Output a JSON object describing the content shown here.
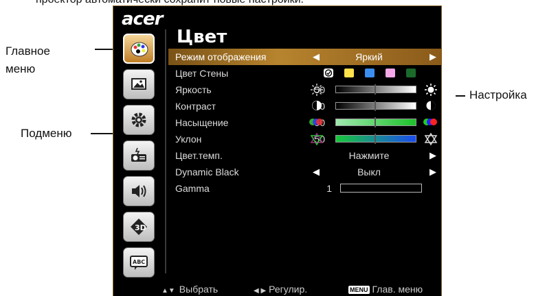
{
  "top_caption": "проектор автоматически сохранит новые настройки.",
  "callouts": {
    "main_menu": "Главное\nменю",
    "submenu": "Подменю",
    "setting": "Настройка"
  },
  "osd": {
    "logo": "acer",
    "title": "Цвет",
    "sidebar_icons": [
      "palette-icon",
      "image-icon",
      "gear-icon",
      "projector-icon",
      "speaker-icon",
      "3d-icon",
      "abc-language-icon"
    ],
    "rows": [
      {
        "label": "Режим отображения",
        "kind": "option",
        "value": "Яркий",
        "highlighted": true
      },
      {
        "label": "Цвет Стены",
        "kind": "swatches",
        "swatches": [
          "#ffe14a",
          "#3b8ef0",
          "#f4a8e8",
          "#1a6a2a"
        ]
      },
      {
        "label": "Яркость",
        "kind": "slider",
        "value": "50",
        "level_pct": 50
      },
      {
        "label": "Контраст",
        "kind": "slider",
        "value": "50",
        "level_pct": 50
      },
      {
        "label": "Насыщение",
        "kind": "slider",
        "value": "50",
        "level_pct": 50
      },
      {
        "label": "Уклон",
        "kind": "slider",
        "value": "50",
        "level_pct": 50
      },
      {
        "label": "Цвет.темп.",
        "kind": "action",
        "value": "Нажмите"
      },
      {
        "label": "Dynamic Black",
        "kind": "option",
        "value": "Выкл"
      },
      {
        "label": "Gamma",
        "kind": "box",
        "value": "1"
      }
    ],
    "hints": {
      "select": "Выбрать",
      "adjust": "Регулир.",
      "menu_badge": "MENU",
      "main_menu": "Глав. меню"
    },
    "accent_color": "#b7842e"
  }
}
